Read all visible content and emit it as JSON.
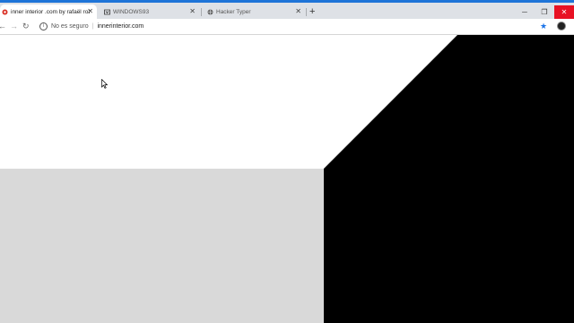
{
  "tabs": [
    {
      "label": "inner interior .com by rafaël rozendaal",
      "active": true,
      "icon": "site-favicon"
    },
    {
      "label": "WINDOWS93",
      "active": false,
      "icon": "windows93-favicon"
    },
    {
      "label": "Hacker Typer",
      "active": false,
      "icon": "globe-icon"
    }
  ],
  "toolbar": {
    "security_label": "No es seguro",
    "url": "innerinterior.com"
  },
  "colors": {
    "accent": "#1e74d8",
    "tab_strip": "#dee1e6",
    "page_gray": "#d9d9d9",
    "page_black": "#000000",
    "page_white": "#ffffff"
  }
}
